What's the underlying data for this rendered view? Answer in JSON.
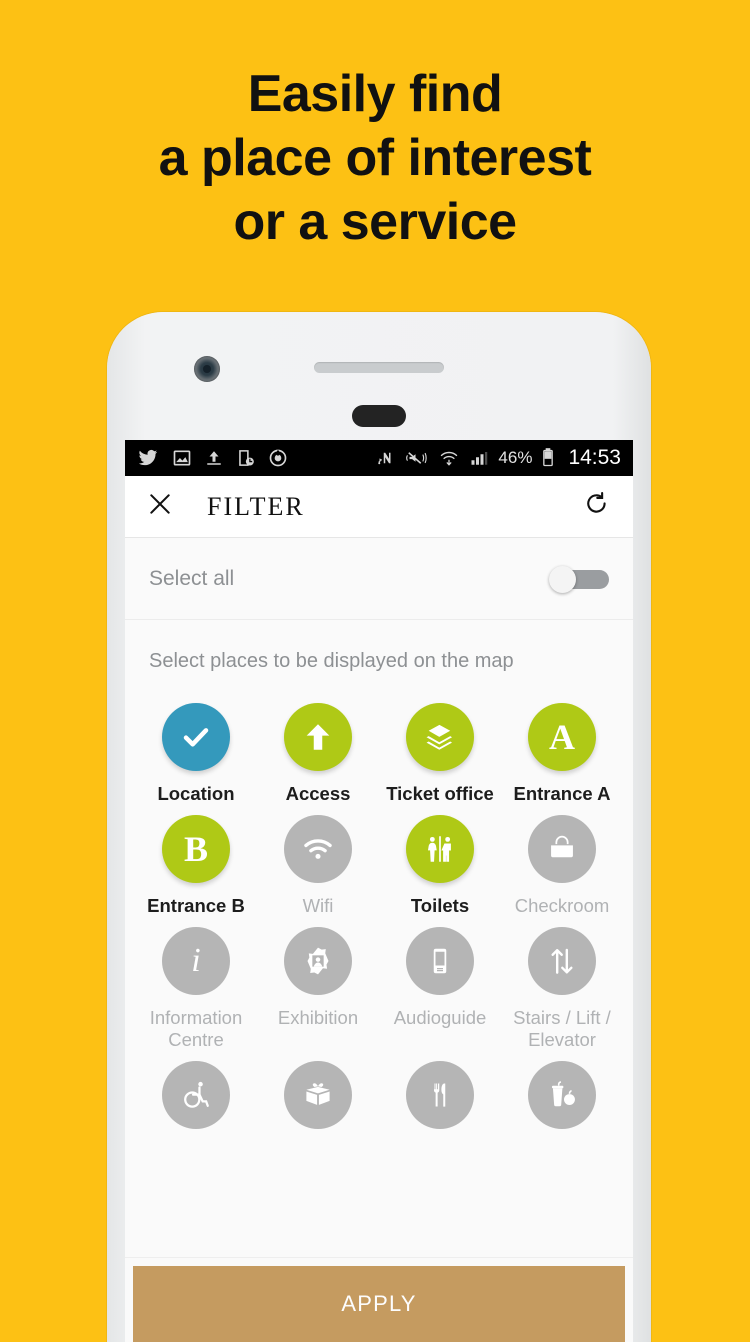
{
  "promo": {
    "headline_lines": [
      "Easily find",
      "a place of interest",
      "or a service"
    ],
    "background_color": "#FDC114"
  },
  "status_bar": {
    "icons_left": [
      "twitter-icon",
      "image-icon",
      "upload-icon",
      "screenshot-timer-icon",
      "power-saver-icon"
    ],
    "icons_right": [
      "nfc-icon",
      "mute-vibrate-icon",
      "wifi-icon",
      "signal-icon"
    ],
    "battery_percent": "46%",
    "battery_icon": "battery-icon",
    "clock": "14:53"
  },
  "app_bar": {
    "close_icon": "close-icon",
    "title": "FILTER",
    "reset_icon": "reset-icon"
  },
  "select_all": {
    "label": "Select all",
    "toggle_state": "off"
  },
  "hint": "Select places to be displayed on the map",
  "colors": {
    "selected_blue": "#3499BC",
    "selected_green": "#AFC916",
    "unselected_grey": "#B5B5B5",
    "apply_button": "#C59B60",
    "label_on": "#1d1d1d",
    "label_off": "#b0b2b4"
  },
  "filters": [
    {
      "label": "Location",
      "icon": "check-icon",
      "state": "selected",
      "color": "#3499BC"
    },
    {
      "label": "Access",
      "icon": "arrow-up-icon",
      "state": "selected",
      "color": "#AFC916"
    },
    {
      "label": "Ticket office",
      "icon": "tickets-icon",
      "state": "selected",
      "color": "#AFC916"
    },
    {
      "label": "Entrance A",
      "icon": "letter-a-icon",
      "state": "selected",
      "color": "#AFC916"
    },
    {
      "label": "Entrance B",
      "icon": "letter-b-icon",
      "state": "selected",
      "color": "#AFC916"
    },
    {
      "label": "Wifi",
      "icon": "wifi-icon",
      "state": "unselected",
      "color": "#B5B5B5"
    },
    {
      "label": "Toilets",
      "icon": "toilets-icon",
      "state": "selected",
      "color": "#AFC916"
    },
    {
      "label": "Checkroom",
      "icon": "bag-icon",
      "state": "unselected",
      "color": "#B5B5B5"
    },
    {
      "label": "Information Centre",
      "icon": "info-icon",
      "state": "unselected",
      "color": "#B5B5B5"
    },
    {
      "label": "Exhibition",
      "icon": "picture-frame-icon",
      "state": "unselected",
      "color": "#B5B5B5"
    },
    {
      "label": "Audioguide",
      "icon": "audioguide-icon",
      "state": "unselected",
      "color": "#B5B5B5"
    },
    {
      "label": "Stairs / Lift / Elevator",
      "icon": "up-down-arrows-icon",
      "state": "unselected",
      "color": "#B5B5B5"
    },
    {
      "label": "",
      "icon": "wheelchair-icon",
      "state": "unselected",
      "color": "#B5B5B5"
    },
    {
      "label": "",
      "icon": "gift-icon",
      "state": "unselected",
      "color": "#B5B5B5"
    },
    {
      "label": "",
      "icon": "cutlery-icon",
      "state": "unselected",
      "color": "#B5B5B5"
    },
    {
      "label": "",
      "icon": "food-drink-icon",
      "state": "unselected",
      "color": "#B5B5B5"
    }
  ],
  "apply_button": {
    "label": "APPLY"
  }
}
